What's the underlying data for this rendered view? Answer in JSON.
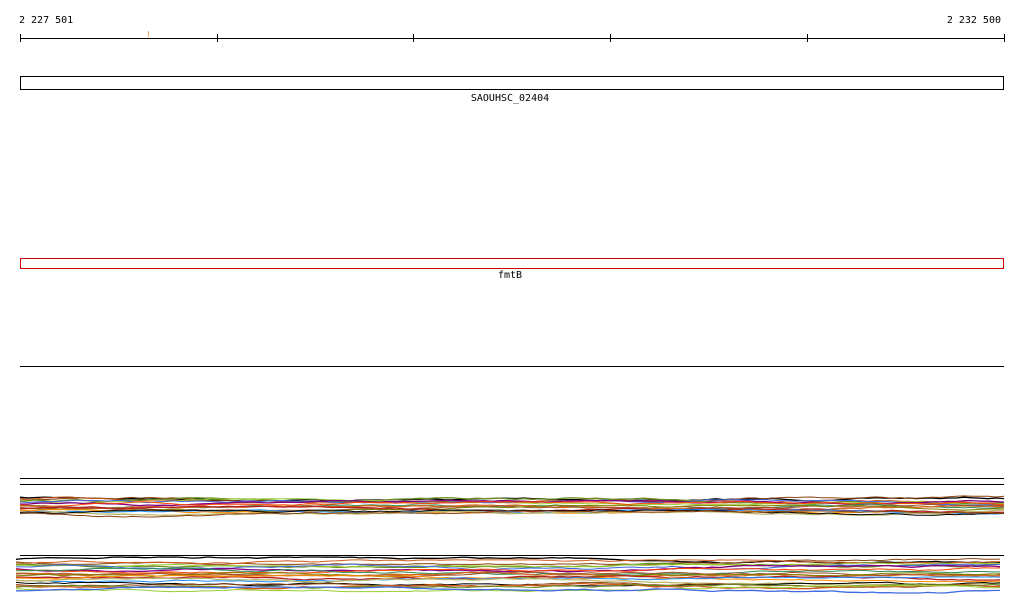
{
  "axis": {
    "start_label": "2 227 501",
    "end_label": "2 232 500",
    "start": 2227501,
    "end": 2232500,
    "major_ticks": [
      2227501,
      2228500,
      2229500,
      2230500,
      2231500,
      2232500
    ],
    "minor_ticks": [
      2228150
    ],
    "minor_tick_color": "#f4a460"
  },
  "features": [
    {
      "name": "SAOUHSC_02404",
      "start": 2227501,
      "end": 2232500,
      "color": "#000000"
    },
    {
      "name": "fmtB",
      "start": 2227501,
      "end": 2232500,
      "color": "#cc0000"
    }
  ],
  "tracks": {
    "colors": [
      "#000000",
      "#8b4513",
      "#cd5c1e",
      "#6b8e23",
      "#9acd32",
      "#4169e1",
      "#800080",
      "#ff4500",
      "#2e8b57",
      "#d2691e",
      "#a0522d",
      "#808000",
      "#b22222",
      "#ff8c00",
      "#1e90ff",
      "#bdb76b"
    ]
  }
}
